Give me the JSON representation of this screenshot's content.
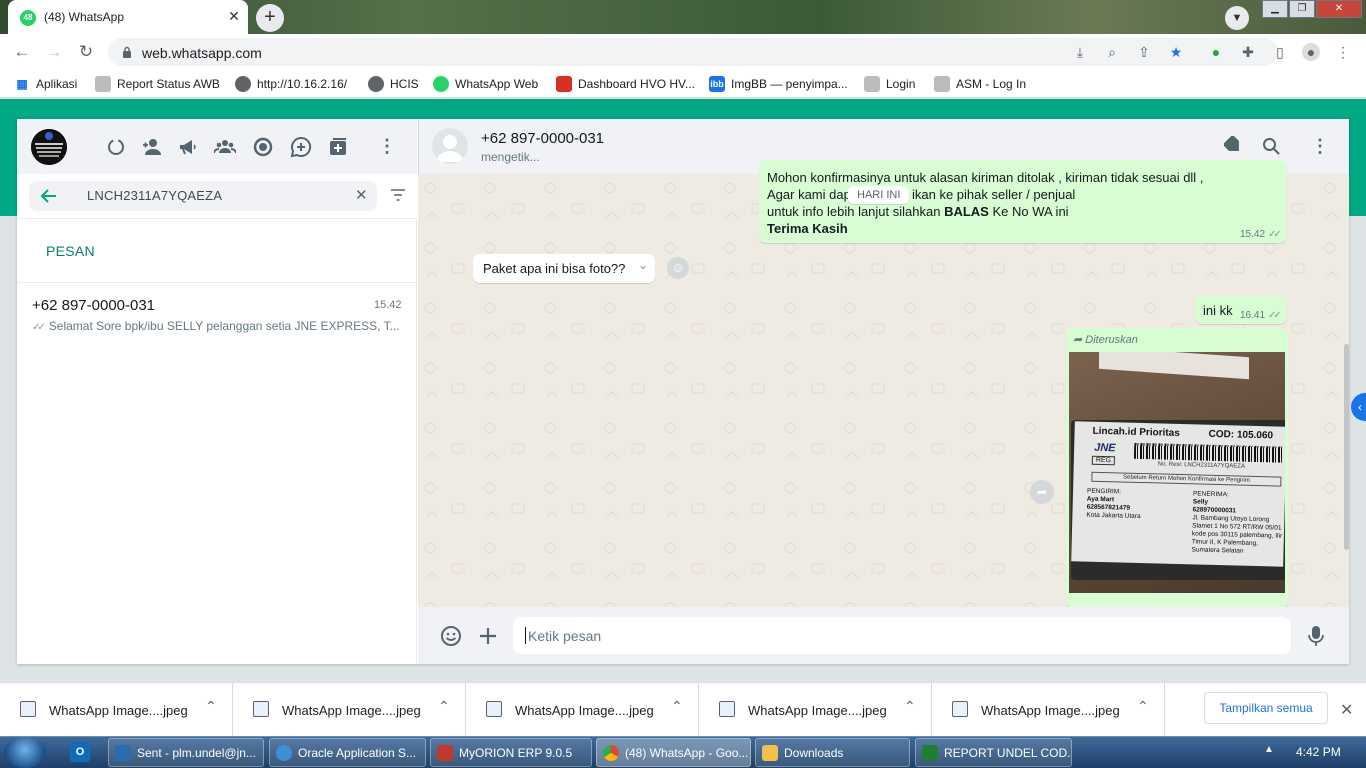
{
  "browser": {
    "tab_title": "(48) WhatsApp",
    "tab_badge": "48",
    "url": "web.whatsapp.com"
  },
  "bookmarks": [
    {
      "label": "Aplikasi",
      "icon": "apps-grid-icon"
    },
    {
      "label": "Report Status AWB",
      "icon": "page-icon"
    },
    {
      "label": "http://10.16.2.16/",
      "icon": "globe-icon"
    },
    {
      "label": "HCIS",
      "icon": "globe-icon"
    },
    {
      "label": "WhatsApp Web",
      "icon": "whatsapp-icon"
    },
    {
      "label": "Dashboard HVO HV...",
      "icon": "dashboard-icon"
    },
    {
      "label": "ImgBB — penyimpa...",
      "icon": "ibb-icon"
    },
    {
      "label": "Login",
      "icon": "page-icon"
    },
    {
      "label": "ASM - Log In",
      "icon": "page-icon"
    }
  ],
  "sidebar": {
    "search_value": "LNCH2311A7YQAEZA",
    "section_label": "PESAN",
    "result": {
      "name": "+62 897-0000-031",
      "time": "15.42",
      "preview": "Selamat Sore  bpk/ibu SELLY pelanggan setia JNE EXPRESS, T..."
    }
  },
  "conversation": {
    "contact_name": "+62 897-0000-031",
    "status": "mengetik...",
    "date_chip": "HARI INI",
    "messages": [
      {
        "dir": "out",
        "lines": [
          "Mohon konfirmasinya untuk alasan kiriman ditolak , kiriman tidak sesuai dll ,",
          "Agar kami dap",
          "ikan ke pihak seller / penjual",
          "untuk info lebih lanjut silahkan ",
          "BALAS",
          " Ke No WA ini",
          "Terima Kasih"
        ],
        "time": "15.42"
      },
      {
        "dir": "in",
        "text": "Paket apa ini bisa foto??"
      },
      {
        "dir": "out",
        "text": "ini kk",
        "time": "16.41"
      },
      {
        "dir": "out",
        "forwarded_label": "Diteruskan",
        "type": "image"
      }
    ],
    "photo": {
      "brand": "Lincah.id Prioritas",
      "cod": "COD: 105.060",
      "courier": "JNE",
      "service": "REG",
      "resi": "No. Resi: LNCH2311A7YQAEZA",
      "notice": "Sebelum Return Mohon Konfirmasi ke Pengirim",
      "sender_label": "PENGIRIM:",
      "sender_name": "Aya Mart",
      "sender_phone": "628567821479",
      "sender_city": "Kota Jakarta Utara",
      "recipient_label": "PENERIMA:",
      "recipient_name": "Selly",
      "recipient_phone": "628970000031",
      "recipient_addr": "Jl. Bambang Utoyo Lorong Slamet 1 No 572 RT/RW 05/01 kode pos 30115 palembang, Ilir Timur II, K Palembang, Sumatera Selatan"
    },
    "input_placeholder": "Ketik pesan"
  },
  "downloads": {
    "items": [
      "WhatsApp Image....jpeg",
      "WhatsApp Image....jpeg",
      "WhatsApp Image....jpeg",
      "WhatsApp Image....jpeg",
      "WhatsApp Image....jpeg"
    ],
    "show_all": "Tampilkan semua"
  },
  "taskbar": {
    "items": [
      {
        "label": "Sent - plm.undel@jn...",
        "color": "#2b6cb0"
      },
      {
        "label": "Oracle Application S...",
        "color": "#3f8fd6"
      },
      {
        "label": "MyORION ERP 9.0.5",
        "color": "#c0392b"
      },
      {
        "label": "(48) WhatsApp - Goo...",
        "color": "#f4b400"
      },
      {
        "label": "Downloads",
        "color": "#f0c14b"
      },
      {
        "label": "REPORT UNDEL COD...",
        "color": "#1e7e34"
      }
    ],
    "clock": "4:42 PM"
  },
  "colors": {
    "wa_green": "#00a884",
    "bubble_out": "#d9fdd3",
    "chrome_blue": "#1a73e8"
  }
}
